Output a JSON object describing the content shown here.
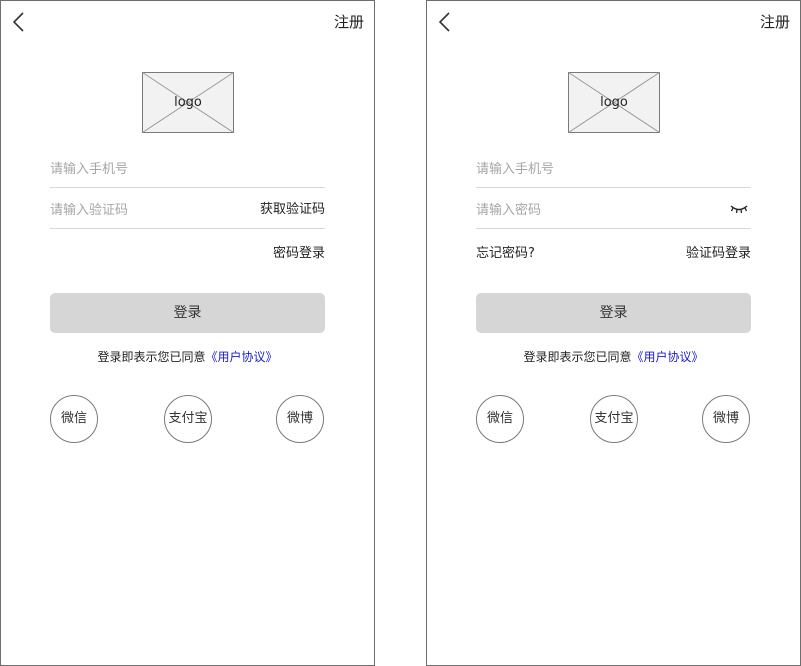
{
  "screens": [
    {
      "register_label": "注册",
      "logo_text": "logo",
      "phone_placeholder": "请输入手机号",
      "second_placeholder": "请输入验证码",
      "get_code_label": "获取验证码",
      "switch_label": "密码登录",
      "login_label": "登录",
      "agreement_text": "登录即表示您已同意",
      "agreement_link": "《用户协议》",
      "social": [
        "微信",
        "支付宝",
        "微博"
      ]
    },
    {
      "register_label": "注册",
      "logo_text": "logo",
      "phone_placeholder": "请输入手机号",
      "second_placeholder": "请输入密码",
      "forgot_label": "忘记密码?",
      "switch_label": "验证码登录",
      "login_label": "登录",
      "agreement_text": "登录即表示您已同意",
      "agreement_link": "《用户协议》",
      "social": [
        "微信",
        "支付宝",
        "微博"
      ]
    }
  ],
  "icons": {
    "back": "chevron-left-icon",
    "logo": "image-placeholder-icon",
    "password_toggle": "eye-closed-icon"
  },
  "colors": {
    "border": "#6e6e6e",
    "button_bg": "#d6d6d6",
    "link": "#1a1ad0",
    "placeholder": "#a6a6a6"
  }
}
